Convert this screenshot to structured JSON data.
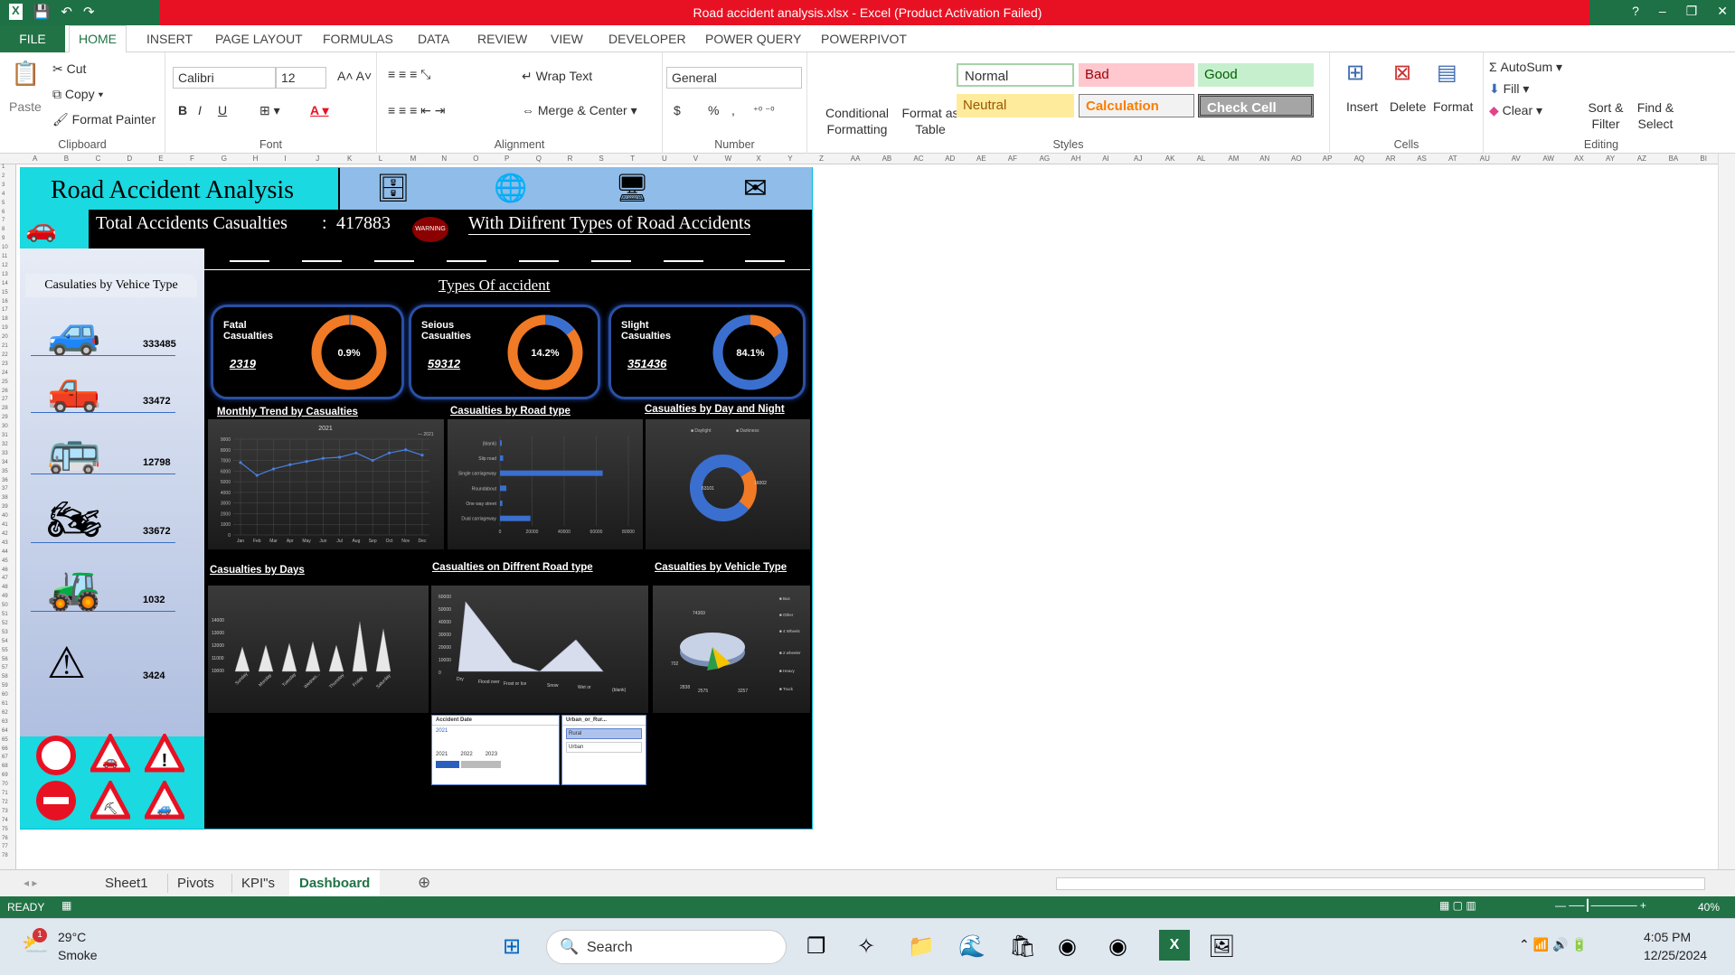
{
  "window": {
    "title": "Road accident analysis.xlsx -  Excel (Product Activation Failed)",
    "help": "?",
    "controls": [
      "–",
      "❐",
      "✕"
    ]
  },
  "ribbon_tabs": [
    "FILE",
    "HOME",
    "INSERT",
    "PAGE LAYOUT",
    "FORMULAS",
    "DATA",
    "REVIEW",
    "VIEW",
    "DEVELOPER",
    "POWER QUERY",
    "POWERPIVOT"
  ],
  "clipboard": {
    "paste": "Paste",
    "cut": "Cut",
    "copy": "Copy",
    "format_painter": "Format Painter",
    "label": "Clipboard"
  },
  "font": {
    "name": "Calibri",
    "size": "12",
    "label": "Font",
    "bold": "B",
    "italic": "I",
    "underline": "U"
  },
  "alignment": {
    "wrap": "Wrap Text",
    "merge": "Merge & Center",
    "label": "Alignment"
  },
  "number": {
    "format": "General",
    "label": "Number",
    "currency": "$",
    "percent": "%",
    "comma": ","
  },
  "styles": {
    "conditional": "Conditional Formatting",
    "format_table": "Format as Table",
    "normal": "Normal",
    "bad": "Bad",
    "good": "Good",
    "neutral": "Neutral",
    "calculation": "Calculation",
    "check": "Check Cell",
    "label": "Styles"
  },
  "cells": {
    "insert": "Insert",
    "delete": "Delete",
    "format": "Format",
    "label": "Cells"
  },
  "editing": {
    "autosum": "AutoSum",
    "fill": "Fill",
    "clear": "Clear",
    "sort": "Sort & Filter",
    "find": "Find & Select",
    "label": "Editing"
  },
  "columns": [
    "A",
    "B",
    "C",
    "D",
    "E",
    "F",
    "G",
    "H",
    "I",
    "J",
    "K",
    "L",
    "M",
    "N",
    "O",
    "P",
    "Q",
    "R",
    "S",
    "T",
    "U",
    "V",
    "W",
    "X",
    "Y",
    "Z",
    "AA",
    "AB",
    "AC",
    "AD",
    "AE",
    "AF",
    "AG",
    "AH",
    "AI",
    "AJ",
    "AK",
    "AL",
    "AM",
    "AN",
    "AO",
    "AP",
    "AQ",
    "AR",
    "AS",
    "AT",
    "AU",
    "AV",
    "AW",
    "AX",
    "AY",
    "AZ",
    "BA",
    "BI"
  ],
  "dashboard": {
    "title": "Road Accident Analysis",
    "total_label": "Total Accidents Casualties",
    "total_sep": ":",
    "total_value": "417883",
    "subtitle": "With Diifrent Types of Road Accidents",
    "badge": "WARNING",
    "types_title": "Types Of accident",
    "vehicle_title": "Casulaties by Vehice Type",
    "vehicles": [
      {
        "icon": "car-icon",
        "value": "333485"
      },
      {
        "icon": "pickup-truck-icon",
        "value": "33472"
      },
      {
        "icon": "bus-icon",
        "value": "12798"
      },
      {
        "icon": "motorcycle-icon",
        "value": "33672"
      },
      {
        "icon": "bulldozer-icon",
        "value": "1032"
      },
      {
        "icon": "warning-sign-icon",
        "value": "3424"
      }
    ],
    "kpis": [
      {
        "label1": "Fatal",
        "label2": "Casualties",
        "value": "2319",
        "pct": "0.9%",
        "fraction": 0.009
      },
      {
        "label1": "Seious",
        "label2": "Casualties",
        "value": "59312",
        "pct": "14.2%",
        "fraction": 0.142
      },
      {
        "label1": "Slight",
        "label2": "Casualties",
        "value": "351436",
        "pct": "84.1%",
        "fraction": 0.841
      }
    ],
    "chart_titles": {
      "monthly": "Monthly Trend by Casualties",
      "road": "Casualties by Road type",
      "daynight": "Casualties by Day and Night",
      "days": "Casualties by Days",
      "road3d": "Casualties on Diffrent Road type",
      "vehicle3d": "Casualties by Vehicle Type"
    },
    "slicers": {
      "date_title": "Accident Date",
      "date_value": "2021",
      "date_years": [
        "2021",
        "2022",
        "2023"
      ],
      "area_title": "Urban_or_Rur...",
      "area_items": [
        "Rural",
        "Urban"
      ]
    }
  },
  "chart_data": [
    {
      "type": "line",
      "title": "2021",
      "legend": [
        "2021"
      ],
      "categories": [
        "Jan",
        "Feb",
        "Mar",
        "Apr",
        "May",
        "Jun",
        "Jul",
        "Aug",
        "Sep",
        "Oct",
        "Nov",
        "Dec"
      ],
      "series": [
        {
          "name": "2021",
          "values": [
            6800,
            5600,
            6200,
            6600,
            6900,
            7200,
            7300,
            7700,
            7000,
            7700,
            8000,
            7500
          ]
        }
      ],
      "ylim": [
        0,
        9000
      ],
      "yticks": [
        "0",
        "1000",
        "2000",
        "3000",
        "4000",
        "5000",
        "6000",
        "7000",
        "8000",
        "9000"
      ]
    },
    {
      "type": "bar",
      "orientation": "horizontal",
      "categories": [
        "(blank)",
        "Slip road",
        "Single carriageway",
        "Roundabout",
        "One way street",
        "Dual carriageway"
      ],
      "values": [
        0,
        2000,
        64000,
        4000,
        1500,
        19000
      ],
      "xlim": [
        0,
        80000
      ],
      "xticks": [
        "0",
        "20000",
        "40000",
        "60000",
        "80000"
      ]
    },
    {
      "type": "pie",
      "style": "doughnut",
      "legend": [
        "Daylight",
        "Darkness"
      ],
      "values": [
        63101,
        16002
      ],
      "labels": [
        "63101",
        "16002"
      ],
      "colors": [
        "#3a6fd0",
        "#f07a25"
      ]
    }
  ],
  "sheet_tabs": [
    "Sheet1",
    "Pivots",
    "KPI\"s",
    "Dashboard"
  ],
  "status": {
    "ready": "READY",
    "zoom": "40%"
  },
  "taskbar": {
    "temp": "29°C",
    "weather": "Smoke",
    "search": "Search",
    "time": "4:05 PM",
    "date": "12/25/2024",
    "badge": "1"
  }
}
